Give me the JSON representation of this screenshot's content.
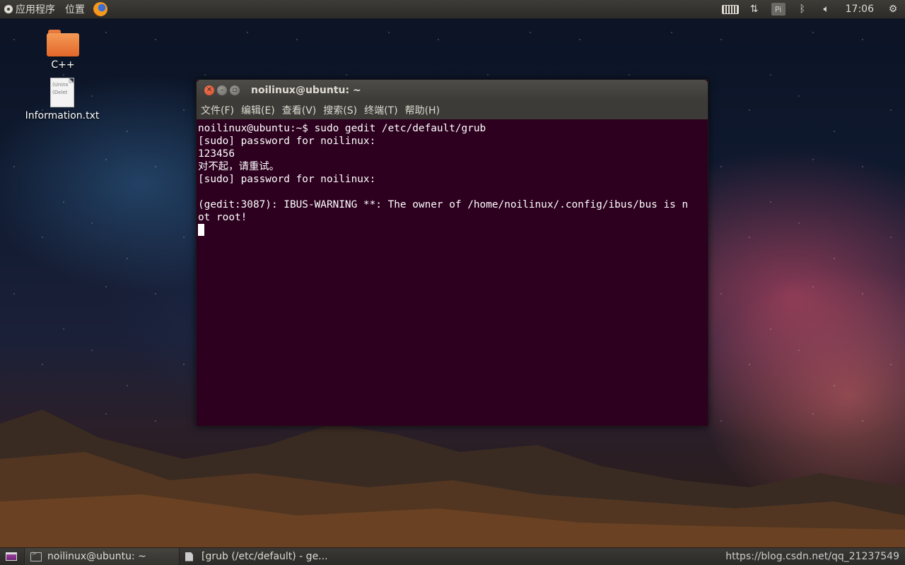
{
  "top_panel": {
    "applications_label": "应用程序",
    "places_label": "位置",
    "clock": "17:06",
    "keyboard_indicator": "Pi"
  },
  "desktop": {
    "icons": [
      {
        "label": "C++",
        "type": "folder"
      },
      {
        "label": "Information.txt",
        "type": "text-file",
        "preview_lines": [
          "(Unins",
          "(Delet"
        ]
      }
    ]
  },
  "window": {
    "title": "noilinux@ubuntu: ~",
    "menu": [
      "文件(F)",
      "编辑(E)",
      "查看(V)",
      "搜索(S)",
      "终端(T)",
      "帮助(H)"
    ],
    "terminal_lines": [
      "noilinux@ubuntu:~$ sudo gedit /etc/default/grub",
      "[sudo] password for noilinux:",
      "123456",
      "对不起，请重试。",
      "[sudo] password for noilinux:",
      "",
      "(gedit:3087): IBUS-WARNING **: The owner of /home/noilinux/.config/ibus/bus is n",
      "ot root!"
    ]
  },
  "taskbar": {
    "tasks": [
      {
        "label": "noilinux@ubuntu: ~"
      },
      {
        "label": "[grub (/etc/default) - ge..."
      }
    ],
    "watermark": "https://blog.csdn.net/qq_21237549"
  }
}
